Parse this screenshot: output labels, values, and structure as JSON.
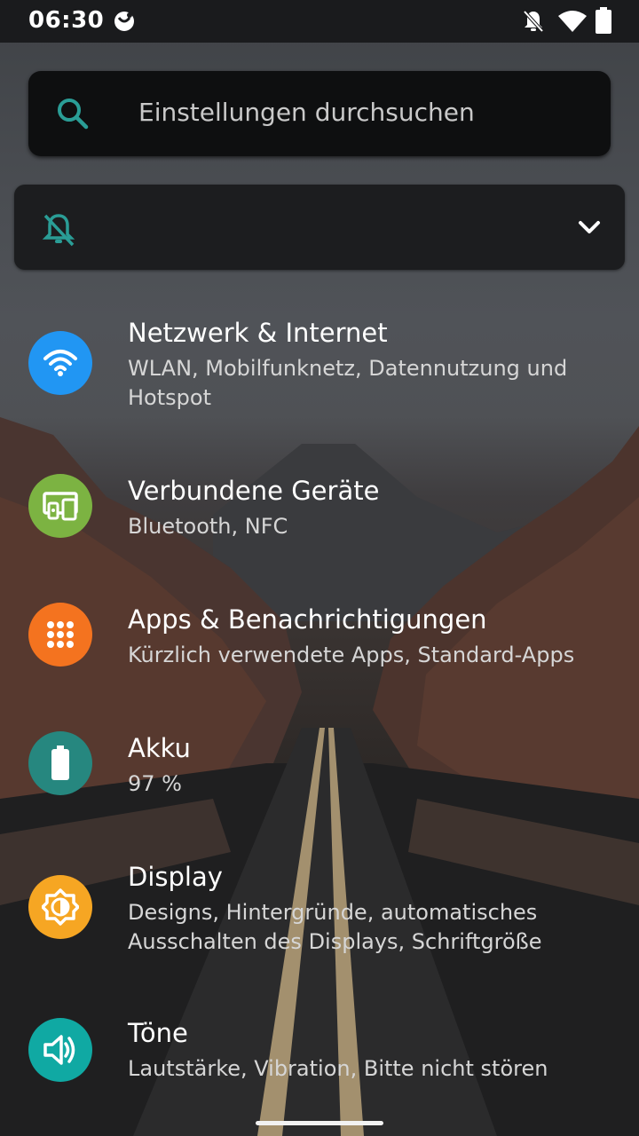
{
  "status_bar": {
    "time": "06:30",
    "icons": [
      "app-notification-icon",
      "do-not-disturb-off-icon",
      "wifi-icon",
      "battery-icon"
    ]
  },
  "search": {
    "placeholder": "Einstellungen durchsuchen",
    "icon": "search-icon"
  },
  "condition_card": {
    "icon": "notifications-off-icon",
    "expand_icon": "chevron-down-icon"
  },
  "settings": [
    {
      "title": "Netzwerk & Internet",
      "subtitle": "WLAN, Mobilfunknetz, Datennutzung und Hotspot",
      "icon": "wifi-icon",
      "color": "#2196f3"
    },
    {
      "title": "Verbundene Geräte",
      "subtitle": "Bluetooth, NFC",
      "icon": "connected-devices-icon",
      "color": "#7cb342"
    },
    {
      "title": "Apps & Benachrichtigungen",
      "subtitle": "Kürzlich verwendete Apps, Standard-Apps",
      "icon": "apps-grid-icon",
      "color": "#f4731f"
    },
    {
      "title": "Akku",
      "subtitle": "97 %",
      "icon": "battery-icon",
      "color": "#26877f"
    },
    {
      "title": "Display",
      "subtitle": "Designs, Hintergründe, automatisches Ausschalten des Displays, Schriftgröße",
      "icon": "brightness-icon",
      "color": "#f6a623"
    },
    {
      "title": "Töne",
      "subtitle": "Lautstärke, Vibration, Bitte nicht stören",
      "icon": "volume-icon",
      "color": "#10a9a3"
    }
  ]
}
